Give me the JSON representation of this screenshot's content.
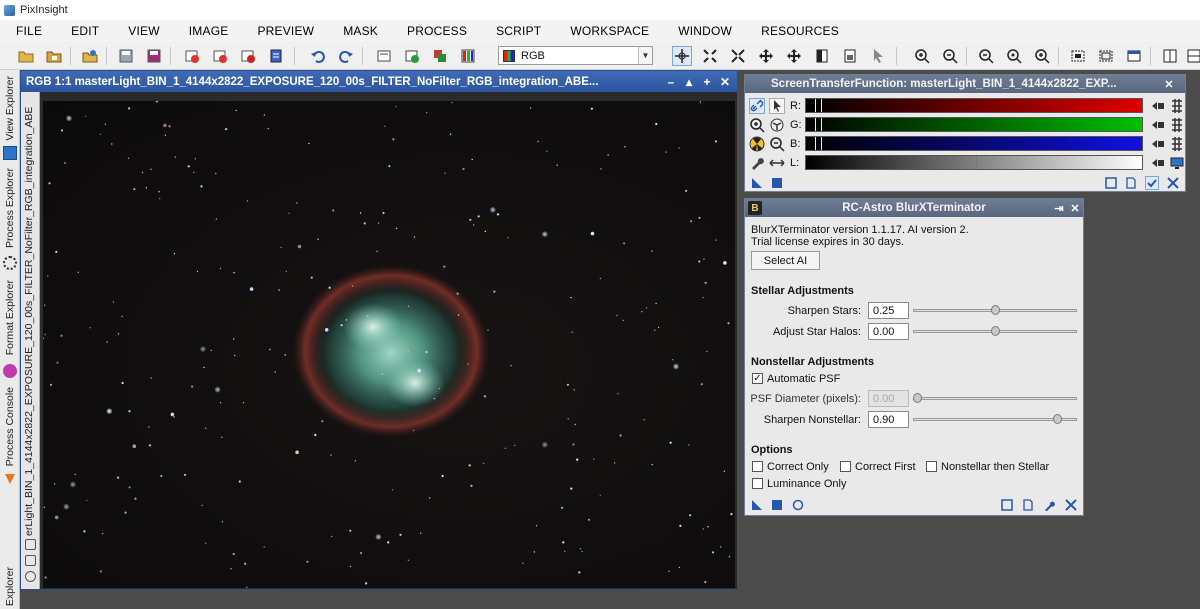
{
  "app": {
    "title": "PixInsight"
  },
  "menu": [
    "FILE",
    "EDIT",
    "VIEW",
    "IMAGE",
    "PREVIEW",
    "MASK",
    "PROCESS",
    "SCRIPT",
    "WORKSPACE",
    "WINDOW",
    "RESOURCES"
  ],
  "toolbar": {
    "color_mode": "RGB"
  },
  "left_dock": {
    "tabs": [
      "View Explorer",
      "Process Explorer",
      "Format Explorer",
      "Process Console",
      "Explorer"
    ]
  },
  "image_window": {
    "title": "RGB 1:1 masterLight_BIN_1_4144x2822_EXPOSURE_120_00s_FILTER_NoFilter_RGB_integration_ABE...",
    "side_label": "erLight_BIN_1_4144x2822_EXPOSURE_120_00s_FILTER_NoFilter_RGB_integration_ABE"
  },
  "stf": {
    "title": "ScreenTransferFunction: masterLight_BIN_1_4144x2822_EXP...",
    "channels": [
      {
        "label": "R:",
        "color_start": "#000000",
        "color_end": "#e00000"
      },
      {
        "label": "G:",
        "color_start": "#000000",
        "color_end": "#00c000"
      },
      {
        "label": "B:",
        "color_start": "#000000",
        "color_end": "#1010e0"
      },
      {
        "label": "L:",
        "color_start": "#000000",
        "color_end": "#ffffff"
      }
    ]
  },
  "blurx": {
    "badge": "B",
    "title": "RC-Astro BlurXTerminator",
    "version_text": "BlurXTerminator version 1.1.17. AI version 2.",
    "license_text": "Trial license expires in 30 days.",
    "select_ai_label": "Select AI",
    "stellar_heading": "Stellar Adjustments",
    "sharpen_stars": {
      "label": "Sharpen Stars:",
      "value": "0.25",
      "fraction": 0.5
    },
    "adjust_halos": {
      "label": "Adjust Star Halos:",
      "value": "0.00",
      "fraction": 0.5
    },
    "nonstellar_heading": "Nonstellar Adjustments",
    "automatic_psf": {
      "label": "Automatic PSF",
      "checked": true
    },
    "psf_diameter": {
      "label": "PSF Diameter (pixels):",
      "value": "0.00",
      "fraction": 0.0
    },
    "sharpen_nonstellar": {
      "label": "Sharpen Nonstellar:",
      "value": "0.90",
      "fraction": 0.9
    },
    "options_heading": "Options",
    "options": [
      {
        "label": "Correct Only",
        "checked": false
      },
      {
        "label": "Correct First",
        "checked": false
      },
      {
        "label": "Nonstellar then Stellar",
        "checked": false
      },
      {
        "label": "Luminance Only",
        "checked": false
      }
    ]
  },
  "colors": {
    "accent": "#3f6ab5",
    "panel_title": "#5e6d85",
    "check_blue": "#2f74c8"
  }
}
